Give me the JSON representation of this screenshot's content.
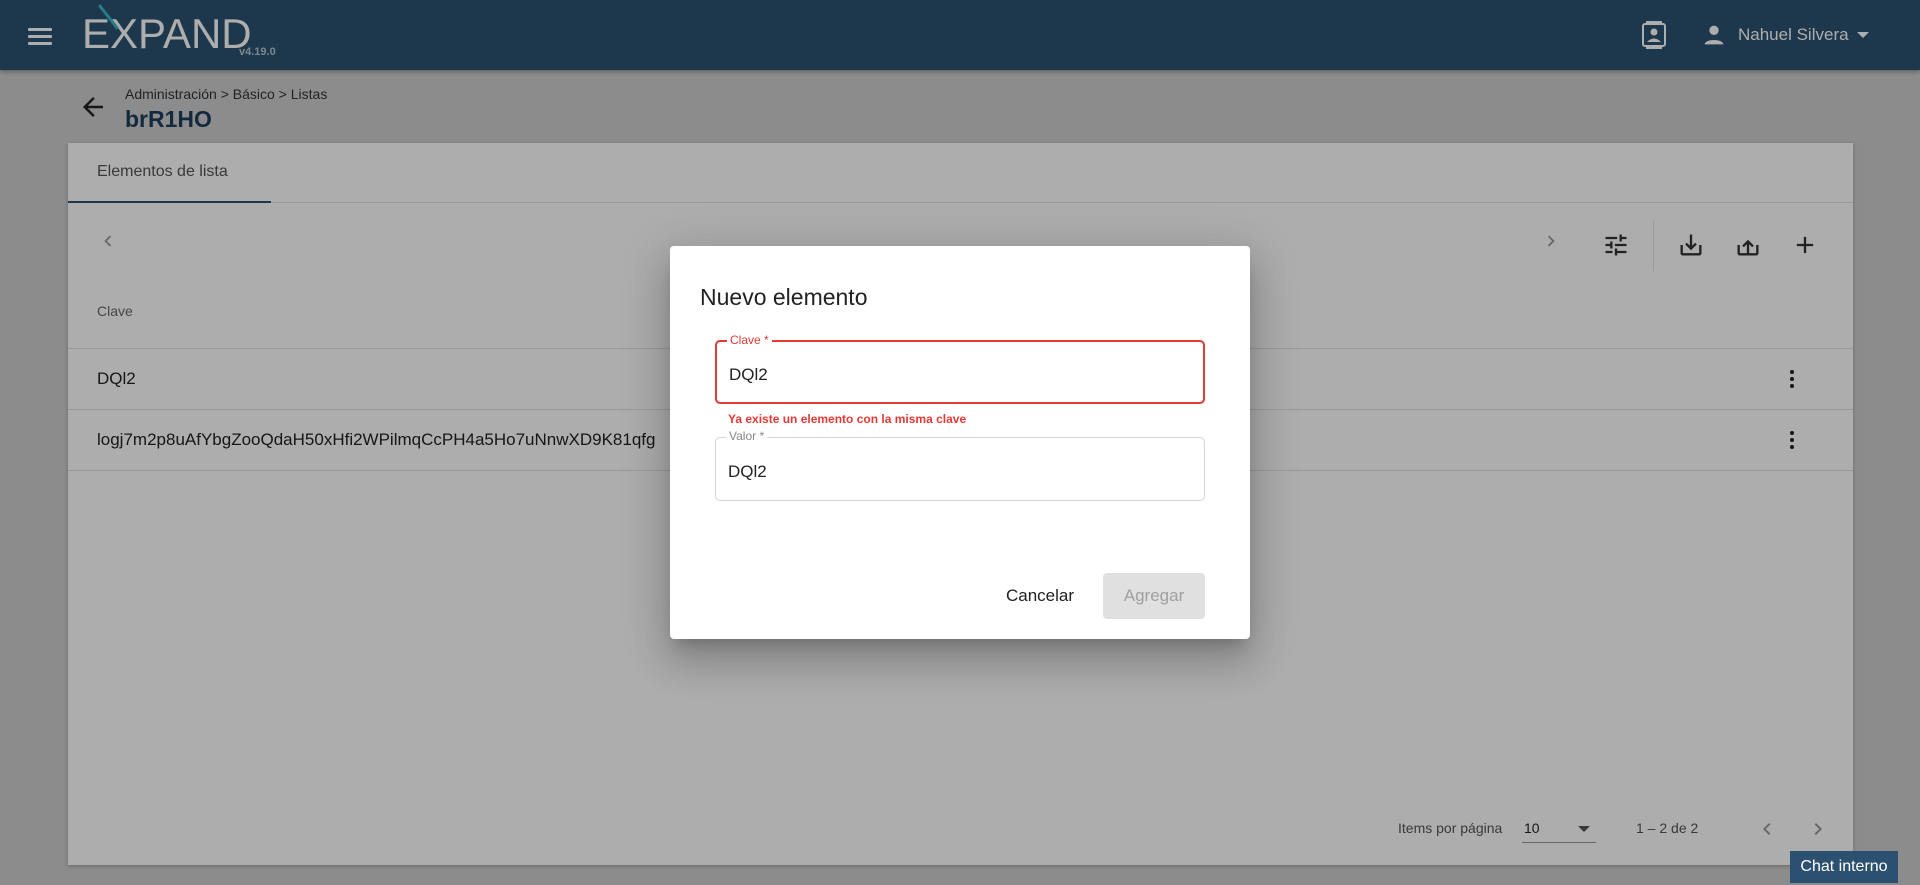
{
  "app": {
    "logo_text": "EXPAND",
    "version": "v4.19.0",
    "user_name": "Nahuel Silvera"
  },
  "header": {
    "breadcrumb": "Administración > Básico > Listas",
    "title": "brR1HO"
  },
  "tabs": [
    {
      "label": "Elementos de lista"
    }
  ],
  "table": {
    "columns": [
      "Clave"
    ],
    "rows": [
      {
        "clave": "DQl2"
      },
      {
        "clave": "logj7m2p8uAfYbgZooQdaH50xHfi2WPilmqCcPH4a5Ho7uNnwXD9K81qfg"
      }
    ]
  },
  "paginator": {
    "items_label": "Items por página",
    "page_size": "10",
    "range": "1 – 2 de 2"
  },
  "chat": {
    "label": "Chat interno"
  },
  "dialog": {
    "title": "Nuevo elemento",
    "clave_label": "Clave *",
    "clave_value": "DQl2",
    "clave_error": "Ya existe un elemento con la misma clave",
    "valor_label": "Valor *",
    "valor_value": "DQl2",
    "cancel_label": "Cancelar",
    "add_label": "Agregar"
  },
  "colors": {
    "topbar": "#2c5170",
    "accent": "#3ab8c8",
    "error": "#e53935"
  },
  "icons": [
    "menu-icon",
    "contacts-icon",
    "user-icon",
    "arrow-back-icon",
    "chevron-left-icon",
    "chevron-right-icon",
    "tune-icon",
    "download-icon",
    "upload-icon",
    "add-icon",
    "more-vert-icon"
  ]
}
